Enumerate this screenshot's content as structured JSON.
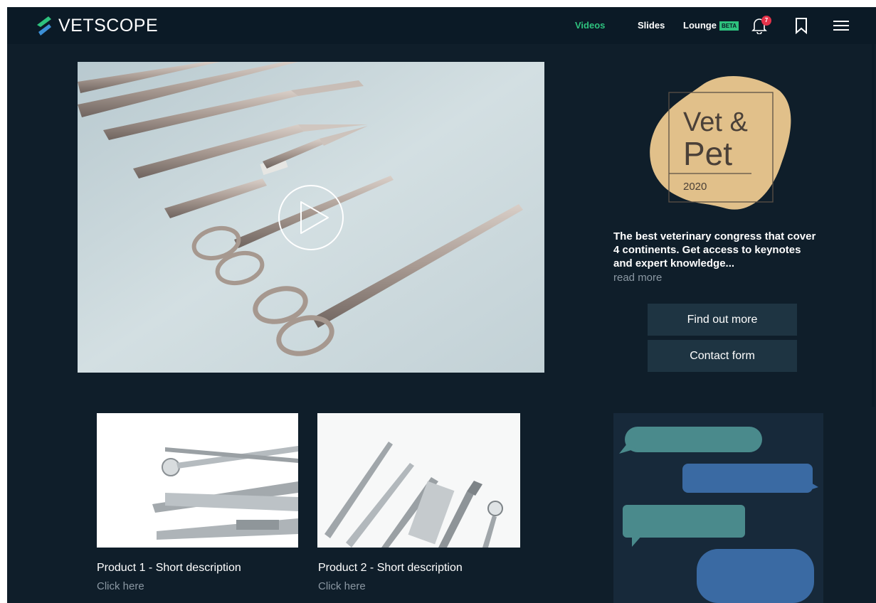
{
  "app": {
    "brand": "VETSCOPE"
  },
  "nav": {
    "videos": "Videos",
    "slides": "Slides",
    "lounge": "Lounge",
    "beta": "BETA",
    "notification_count": "7",
    "active_color": "#2ec27e"
  },
  "icons": {
    "logo": "vetscope-logo-icon",
    "bell": "bell-icon",
    "bookmark": "bookmark-icon",
    "menu": "hamburger-menu-icon",
    "play": "play-icon"
  },
  "event": {
    "logo_line1": "Vet &",
    "logo_line2": "Pet",
    "logo_year": "2020",
    "description": "The best veterinary congress that cover 4 continents. Get access to keynotes and expert knowledge...",
    "read_more": "read more",
    "find_out_more": "Find out more",
    "contact_form": "Contact form"
  },
  "products": [
    {
      "title": "Product 1 - Short description",
      "link": "Click here"
    },
    {
      "title": "Product 2 - Short description",
      "link": "Click here"
    }
  ],
  "colors": {
    "background": "#0f1e2a",
    "navbar": "#0b1a26",
    "button": "#1e3442",
    "chat_teal": "#4a8a8c",
    "chat_blue": "#3a6aa3",
    "event_gold": "#e1c08a"
  }
}
